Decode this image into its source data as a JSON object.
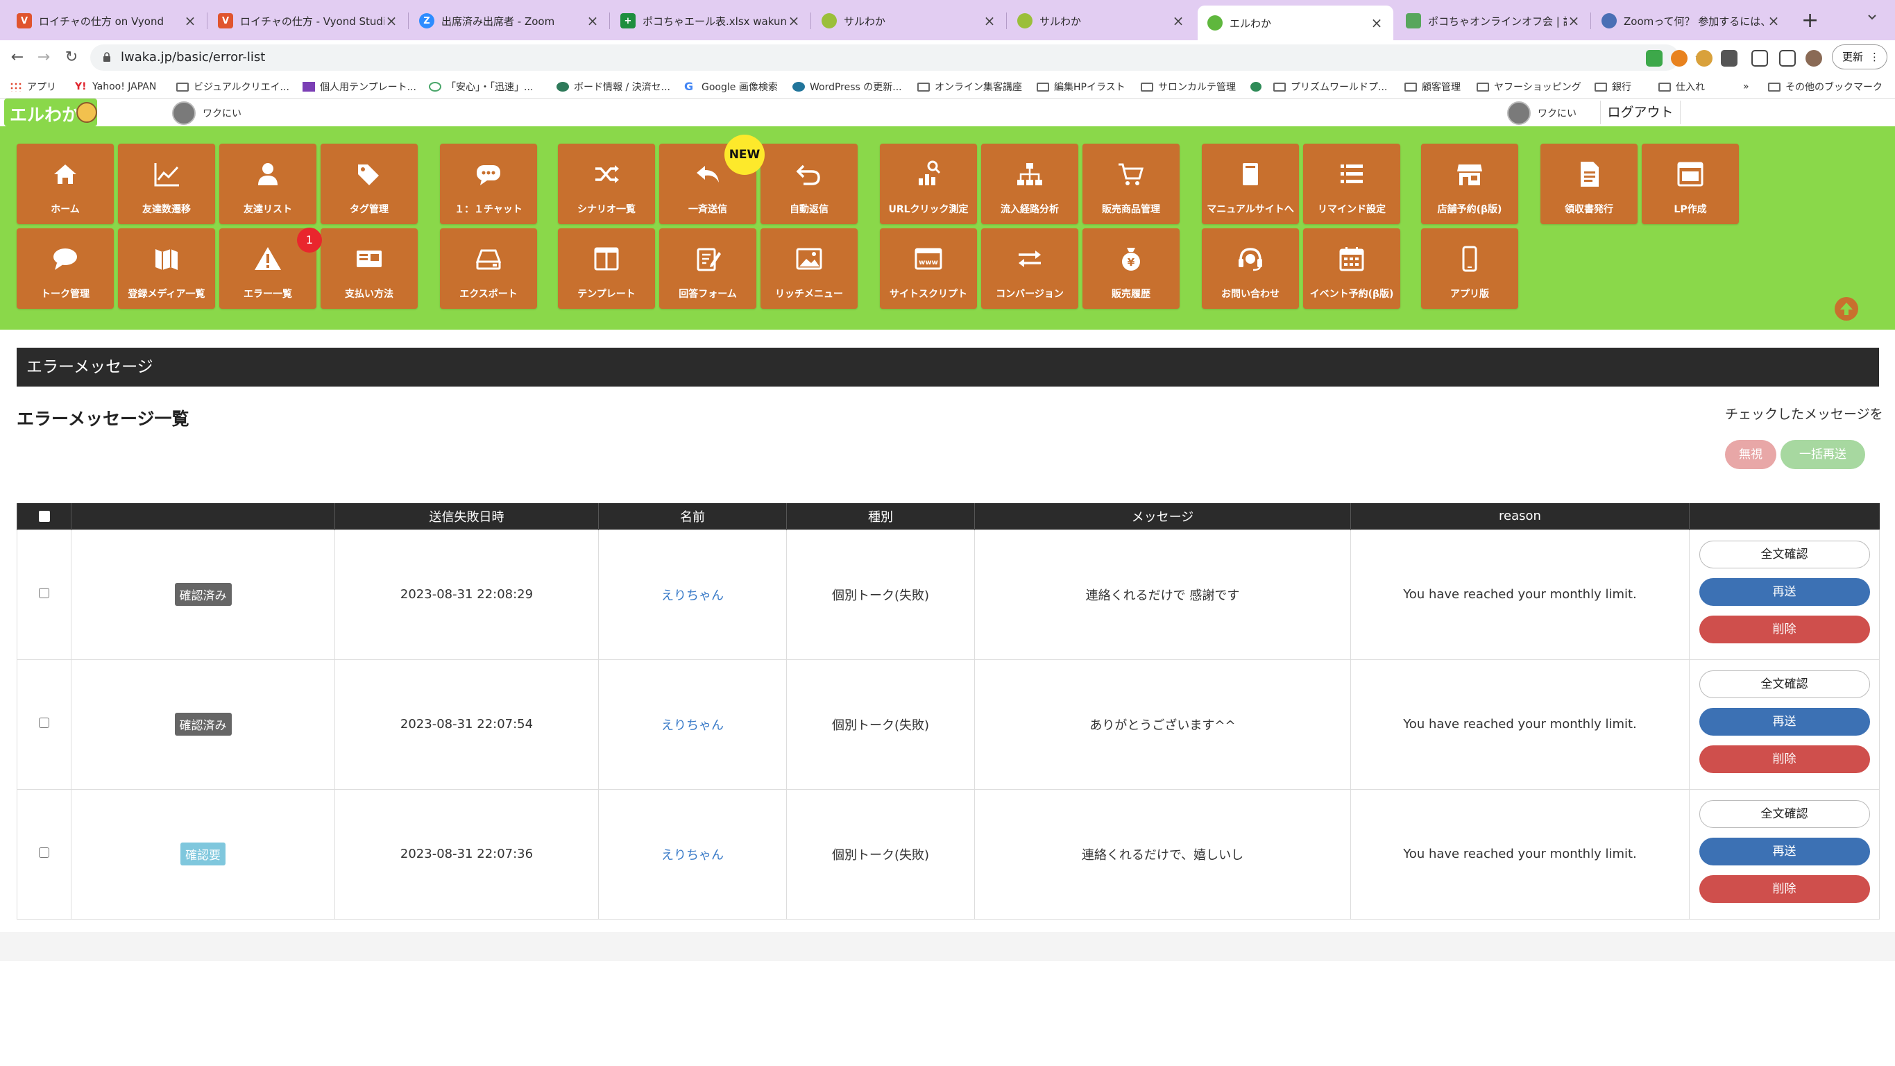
{
  "browser": {
    "tabs": [
      {
        "title": "ロイチャの仕方 on Vyond",
        "favicon": "V",
        "color": "#e0542e"
      },
      {
        "title": "ロイチャの仕方 - Vyond Studio",
        "favicon": "V",
        "color": "#e0542e"
      },
      {
        "title": "出席済み出席者 - Zoom",
        "favicon": "Z",
        "color": "#2d8cff"
      },
      {
        "title": "ポコちゃエール表.xlsx wakuni",
        "favicon": "+",
        "color": "#1e8e3e"
      },
      {
        "title": "サルわか",
        "favicon": "",
        "color": "#9bbf3a"
      },
      {
        "title": "サルわか",
        "favicon": "",
        "color": "#9bbf3a"
      },
      {
        "title": "エルわか",
        "favicon": "",
        "color": "#5fb73d"
      },
      {
        "title": "ポコちゃオンラインオフ会 | 調整",
        "favicon": "",
        "color": "#58a65c"
      },
      {
        "title": "Zoomって何？ 参加するには、どう",
        "favicon": "",
        "color": "#4a6fb5"
      }
    ],
    "active_tab_index": 6,
    "url": "lwaka.jp/basic/error-list",
    "update_label": "更新",
    "bookmarks": [
      "アプリ",
      "Yahoo! JAPAN",
      "ビジュアルクリエイ...",
      "個人用テンプレート...",
      "「安心」・「迅速」...",
      "ボード情報 / 決済セ...",
      "Google 画像検索",
      "WordPress の更新...",
      "オンライン集客講座",
      "編集HPイラスト",
      "サロンカルテ管理",
      "プリズムワールドプ...",
      "顧客管理",
      "ヤフーショッピング",
      "銀行",
      "仕入れ",
      "»",
      "その他のブックマーク"
    ]
  },
  "header": {
    "logo_text": "エルわか",
    "user_name_left": "ワクにい",
    "user_name_right": "ワクにい",
    "logout_label": "ログアウト"
  },
  "menu": {
    "row1": [
      {
        "label": "ホーム",
        "icon": "home-icon"
      },
      {
        "label": "友達数遷移",
        "icon": "line-chart-icon"
      },
      {
        "label": "友達リスト",
        "icon": "user-icon"
      },
      {
        "label": "タグ管理",
        "icon": "tags-icon"
      },
      {
        "label": "１：１チャット",
        "icon": "chat-bubble-icon"
      },
      {
        "label": "シナリオ一覧",
        "icon": "shuffle-icon"
      },
      {
        "label": "一斉送信",
        "icon": "reply-icon"
      },
      {
        "label": "自動返信",
        "icon": "undo-icon"
      },
      {
        "label": "URLクリック測定",
        "icon": "click-chart-icon"
      },
      {
        "label": "流入経路分析",
        "icon": "sitemap-icon"
      },
      {
        "label": "販売商品管理",
        "icon": "cart-icon"
      },
      {
        "label": "マニュアルサイトへ",
        "icon": "book-icon"
      },
      {
        "label": "リマインド設定",
        "icon": "list-icon"
      },
      {
        "label": "店舗予約(β版)",
        "icon": "store-icon"
      },
      {
        "label": "領収書発行",
        "icon": "receipt-icon"
      },
      {
        "label": "LP作成",
        "icon": "webpage-icon"
      }
    ],
    "row2": [
      {
        "label": "トーク管理",
        "icon": "speech-icon"
      },
      {
        "label": "登録メディア一覧",
        "icon": "media-icon"
      },
      {
        "label": "エラー一覧",
        "icon": "warning-icon"
      },
      {
        "label": "支払い方法",
        "icon": "payment-card-icon"
      },
      {
        "label": "エクスポート",
        "icon": "drive-icon"
      },
      {
        "label": "テンプレート",
        "icon": "columns-icon"
      },
      {
        "label": "回答フォーム",
        "icon": "form-edit-icon"
      },
      {
        "label": "リッチメニュー",
        "icon": "image-icon"
      },
      {
        "label": "サイトスクリプト",
        "icon": "www-icon"
      },
      {
        "label": "コンバージョン",
        "icon": "exchange-icon"
      },
      {
        "label": "販売履歴",
        "icon": "money-bag-icon"
      },
      {
        "label": "お問い合わせ",
        "icon": "headset-icon"
      },
      {
        "label": "イベント予約(β版)",
        "icon": "calendar-icon"
      },
      {
        "label": "アプリ版",
        "icon": "mobile-icon"
      }
    ],
    "new_badge": "NEW",
    "error_count": "1"
  },
  "content": {
    "section_title": "エラーメッセージ",
    "list_title": "エラーメッセージ一覧",
    "check_message": "チェックしたメッセージを",
    "ignore_label": "無視",
    "bulk_resend_label": "一括再送"
  },
  "table": {
    "headers": [
      "",
      "",
      "送信失敗日時",
      "名前",
      "種別",
      "メッセージ",
      "reason",
      ""
    ],
    "rows": [
      {
        "status": "確認済み",
        "status_type": "done",
        "datetime": "2023-08-31 22:08:29",
        "name": "えりちゃん",
        "type": "個別トーク(失敗)",
        "message": "連絡くれるだけで 感謝です",
        "reason": "You have reached your monthly limit."
      },
      {
        "status": "確認済み",
        "status_type": "done",
        "datetime": "2023-08-31 22:07:54",
        "name": "えりちゃん",
        "type": "個別トーク(失敗)",
        "message": "ありがとうございます^^",
        "reason": "You have reached your monthly limit."
      },
      {
        "status": "確認要",
        "status_type": "need",
        "datetime": "2023-08-31 22:07:36",
        "name": "えりちゃん",
        "type": "個別トーク(失敗)",
        "message": "連絡くれるだけで、嬉しいし",
        "reason": "You have reached your monthly limit."
      }
    ],
    "actions": {
      "full": "全文確認",
      "resend": "再送",
      "delete": "削除"
    }
  },
  "colors": {
    "menu_bg": "#8ad84a",
    "tile": "#c8702e",
    "resend": "#3c71b4",
    "delete": "#cf4f4c",
    "tab_bar": "#e2cdf2"
  }
}
